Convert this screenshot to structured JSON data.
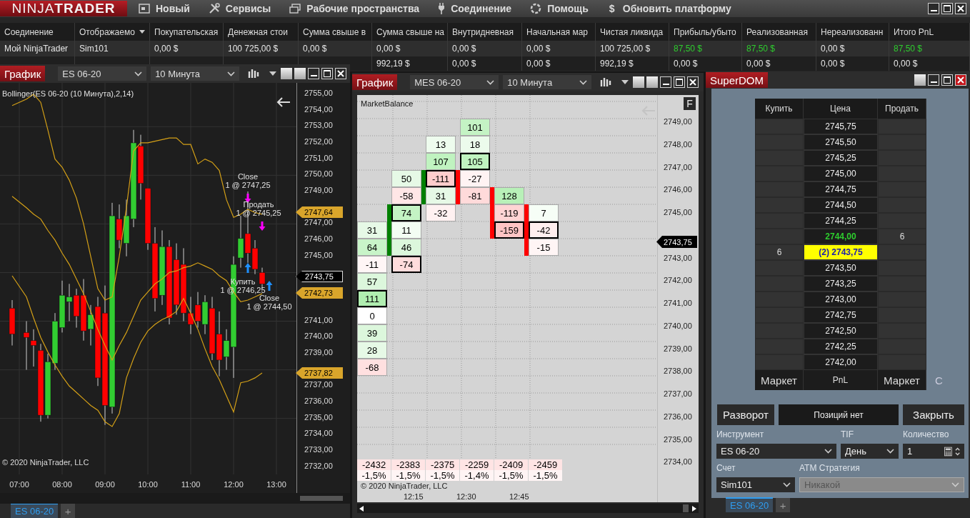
{
  "menu_bar": {
    "logo": "NINJA**TRADER**",
    "items": [
      {
        "label": "Новый",
        "kind": "new"
      },
      {
        "label": "Сервисы",
        "kind": "tools"
      },
      {
        "label": "Рабочие пространства",
        "kind": "workspaces"
      },
      {
        "label": "Соединение",
        "kind": "connection"
      },
      {
        "label": "Помощь",
        "kind": "help"
      },
      {
        "label": "Обновить платформу",
        "kind": "upgrade",
        "glyph": "$"
      }
    ]
  },
  "accounts_table": {
    "columns": [
      {
        "label": "Соединение",
        "kind": "plain"
      },
      {
        "label": "Отображаемо",
        "kind": "menu"
      },
      {
        "label": "Покупательская",
        "kind": "plain"
      },
      {
        "label": "Денежная стои",
        "kind": "plain"
      },
      {
        "label": "Сумма свыше в",
        "kind": "plain"
      },
      {
        "label": "Сумма свыше на",
        "kind": "plain"
      },
      {
        "label": "Внутридневная",
        "kind": "plain"
      },
      {
        "label": "Начальная мар",
        "kind": "plain"
      },
      {
        "label": "Чистая ликвида",
        "kind": "plain"
      },
      {
        "label": "Прибыль/убыто",
        "kind": "plain"
      },
      {
        "label": "Реализованная",
        "kind": "plain"
      },
      {
        "label": "Нереализованн",
        "kind": "plain"
      },
      {
        "label": "Итого PnL",
        "kind": "plain"
      }
    ],
    "rows": [
      {
        "cells": [
          {
            "text": "Мой NinjaTrader",
            "positive": false
          },
          {
            "text": "Sim101",
            "positive": false
          },
          {
            "text": "0,00 $",
            "positive": false
          },
          {
            "text": "100 725,00 $",
            "positive": false
          },
          {
            "text": "0,00 $",
            "positive": false
          },
          {
            "text": "0,00 $",
            "positive": false
          },
          {
            "text": "0,00 $",
            "positive": false
          },
          {
            "text": "0,00 $",
            "positive": false
          },
          {
            "text": "100 725,00 $",
            "positive": false
          },
          {
            "text": "87,50 $",
            "positive": true
          },
          {
            "text": "87,50 $",
            "positive": true
          },
          {
            "text": "0,00 $",
            "positive": false
          },
          {
            "text": "87,50 $",
            "positive": true
          }
        ]
      },
      {
        "cells": [
          null,
          null,
          null,
          null,
          null,
          {
            "text": "992,19 $",
            "positive": false
          },
          {
            "text": "0,00 $",
            "positive": false
          },
          {
            "text": "0,00 $",
            "positive": false
          },
          {
            "text": "992,19 $",
            "positive": false
          },
          {
            "text": "0,00 $",
            "positive": false
          },
          {
            "text": "0,00 $",
            "positive": false
          },
          {
            "text": "0,00 $",
            "positive": false
          },
          {
            "text": "0,00 $",
            "positive": false
          }
        ]
      }
    ]
  },
  "chart_left": {
    "title": "График",
    "instrument": "ES 06-20",
    "interval": "10 Минута",
    "indicator_label": "Bollinger(ES 06-20 (10 Минута),2,14)",
    "chart_data": {
      "type": "candlestick",
      "grid": true,
      "x": [
        410,
        430,
        440,
        450,
        460,
        470,
        480,
        490,
        500,
        510,
        520,
        530,
        540,
        550,
        560,
        570,
        580,
        590,
        600,
        610,
        620,
        630,
        640,
        650,
        660,
        670,
        680,
        690,
        700,
        710,
        720,
        730,
        740,
        750,
        760
      ],
      "ohlc": [
        [
          2741.8,
          2742.3,
          2739.5,
          2740.2
        ],
        [
          2740.3,
          2741,
          2738,
          2740.0
        ],
        [
          2739.8,
          2740.5,
          2738.2,
          2739.5
        ],
        [
          2739.2,
          2739.6,
          2734.8,
          2735.2
        ],
        [
          2735.2,
          2739,
          2735,
          2738.5
        ],
        [
          2738.4,
          2741.5,
          2738,
          2741
        ],
        [
          2740.6,
          2743.5,
          2740.3,
          2742.6
        ],
        [
          2742.2,
          2743.3,
          2741,
          2742.5
        ],
        [
          2742.6,
          2743,
          2740.6,
          2741.3
        ],
        [
          2742.6,
          2743.6,
          2739.8,
          2740.4
        ],
        [
          2740.5,
          2742,
          2739.5,
          2741.4
        ],
        [
          2741.9,
          2742.5,
          2737,
          2737.5
        ],
        [
          2741.5,
          2743.2,
          2734.6,
          2735.8
        ],
        [
          2735.7,
          2748.3,
          2735.3,
          2747.5
        ],
        [
          2747.3,
          2748.2,
          2745.5,
          2746
        ],
        [
          2745.8,
          2748.5,
          2745,
          2747.5
        ],
        [
          2747.3,
          2752.8,
          2746.8,
          2752
        ],
        [
          2751.8,
          2752.5,
          2748.5,
          2749.5
        ],
        [
          2749.2,
          2749.2,
          2745.4,
          2745.8
        ],
        [
          2745.8,
          2746.8,
          2741.6,
          2742.4
        ],
        [
          2742.6,
          2746.6,
          2742,
          2745.6
        ],
        [
          2745.6,
          2746,
          2740.8,
          2741.2
        ],
        [
          2744.8,
          2745.8,
          2741.4,
          2742
        ],
        [
          2744.5,
          2745.5,
          2741,
          2741.5
        ],
        [
          2741.5,
          2742.5,
          2740.2,
          2740.8
        ],
        [
          2742,
          2742.8,
          2740.6,
          2741
        ],
        [
          2740.8,
          2742.6,
          2740.2,
          2742.2
        ],
        [
          2741.8,
          2742.5,
          2738.6,
          2739
        ],
        [
          2740.2,
          2741.6,
          2737.6,
          2738.6
        ],
        [
          2738.8,
          2740.5,
          2738,
          2739.8
        ],
        [
          2739.4,
          2745,
          2737.5,
          2744.5
        ],
        [
          2744.9,
          2747.5,
          2744.3,
          2746.1
        ],
        [
          2746.4,
          2749,
          2744.6,
          2745.2
        ],
        [
          2745.5,
          2746,
          2743.9,
          2744.2
        ],
        [
          2744.0,
          2744.3,
          2743,
          2743.3
        ]
      ],
      "series": [
        {
          "type": "line",
          "color": "#d4a017",
          "values": [
            2754.3,
            2754.7,
            2755,
            2754.5,
            2752.8,
            2751,
            2750.5,
            2749.7,
            2748.6,
            2747,
            2745,
            2743,
            2742.3,
            2742.5,
            2745,
            2748,
            2751.5,
            2752,
            2752,
            2752.1,
            2752.2,
            2752.3,
            2752.3,
            2751.9,
            2751.9,
            2750.7,
            2751,
            2750.8,
            2750.3,
            2748.5,
            2747.4,
            2747.6,
            2747.9,
            2747.7,
            2747.6
          ]
        },
        {
          "type": "line",
          "color": "#d4a017",
          "values": [
            2748.7,
            2748,
            2747.6,
            2747.3,
            2746.6,
            2746,
            2745.2,
            2744.5,
            2743.6,
            2742.7,
            2741.6,
            2740.5,
            2739.5,
            2738.6,
            2739.5,
            2740.3,
            2741.3,
            2742.3,
            2742.8,
            2743.3,
            2743.6,
            2744,
            2744.1,
            2744.3,
            2744.4,
            2744.6,
            2744.4,
            2744.2,
            2743.8,
            2743.5,
            2742.8,
            2742.2,
            2742.3,
            2742.5,
            2742.7
          ]
        },
        {
          "type": "line",
          "color": "#d4a017",
          "values": [
            2743.8,
            2742.5,
            2741.2,
            2740,
            2739.1,
            2738.3,
            2737.6,
            2737,
            2736.6,
            2736.2,
            2735.8,
            2735.5,
            2734.8,
            2734.5,
            2735.3,
            2737.5,
            2738.7,
            2739.7,
            2740.4,
            2740.8,
            2741.1,
            2741.3,
            2741.6,
            2742.4,
            2741.5,
            2740.5,
            2739.3,
            2738.2,
            2737.4,
            2736.4,
            2735.4,
            2737.2,
            2737.3,
            2737.5,
            2737.8
          ]
        }
      ],
      "xlim": [
        393,
        883
      ],
      "xticks": [
        {
          "value": 420,
          "label": "07:00"
        },
        {
          "value": 480,
          "label": "08:00"
        },
        {
          "value": 540,
          "label": "09:00"
        },
        {
          "value": 600,
          "label": "10:00"
        },
        {
          "value": 660,
          "label": "11:00"
        },
        {
          "value": 720,
          "label": "12:00"
        },
        {
          "value": 780,
          "label": "13:00"
        }
      ],
      "yticks": [
        {
          "value": 2755,
          "label": "2755,00"
        },
        {
          "value": 2754,
          "label": "2754,00"
        },
        {
          "value": 2753,
          "label": "2753,00"
        },
        {
          "value": 2752,
          "label": "2752,00"
        },
        {
          "value": 2751,
          "label": "2751,00"
        },
        {
          "value": 2750,
          "label": "2750,00"
        },
        {
          "value": 2749,
          "label": "2749,00"
        },
        {
          "value": 2747,
          "label": "2747,00"
        },
        {
          "value": 2746,
          "label": "2746,00"
        },
        {
          "value": 2745,
          "label": "2745,00"
        },
        {
          "value": 2741,
          "label": "2741,00"
        },
        {
          "value": 2740,
          "label": "2740,00"
        },
        {
          "value": 2739,
          "label": "2739,00"
        },
        {
          "value": 2737,
          "label": "2737,00"
        },
        {
          "value": 2736,
          "label": "2736,00"
        },
        {
          "value": 2735,
          "label": "2735,00"
        },
        {
          "value": 2734,
          "label": "2734,00"
        },
        {
          "value": 2733,
          "label": "2733,00"
        },
        {
          "value": 2732,
          "label": "2732,00"
        }
      ],
      "ylim": [
        2730.4,
        2755.7
      ]
    },
    "price_markers": [
      {
        "text": "2747,64",
        "kind": "indicator"
      },
      {
        "text": "2743,75",
        "kind": "last"
      },
      {
        "text": "2742,73",
        "kind": "indicator"
      },
      {
        "text": "2737,82",
        "kind": "indicator"
      }
    ],
    "orders": [
      {
        "action": "Close",
        "detail": "1 @ 2747,25"
      },
      {
        "action": "Продать",
        "detail": "1 @ 2745,25"
      },
      {
        "action": "Купить",
        "detail": "1 @ 2746,25"
      },
      {
        "action": "Close",
        "detail": "1 @ 2744,50"
      }
    ],
    "copyright": "© 2020 NinjaTrader, LLC",
    "tabs": [
      {
        "label": "ES 06-20",
        "selected": true
      }
    ],
    "add_tab": "+"
  },
  "chart_middle": {
    "title": "График",
    "instrument": "MES 06-20",
    "interval": "10 Минута",
    "indicator_label": "MarketBalance",
    "panel_button": "F",
    "columns": [
      {
        "cells": [
          null,
          null,
          null,
          null,
          null,
          null,
          {
            "value": "31",
            "color": "#e6f9e6",
            "outlined": false
          },
          {
            "value": "64",
            "color": "#c8f4c8",
            "outlined": false
          },
          {
            "value": "-11",
            "color": "#fff6f6",
            "outlined": false
          },
          {
            "value": "57",
            "color": "#dcf7dc",
            "outlined": false
          },
          {
            "value": "111",
            "color": "#b0eeb0",
            "outlined": true
          },
          {
            "value": "0",
            "color": "#ffffff",
            "outlined": false
          },
          {
            "value": "39",
            "color": "#dcf7dc",
            "outlined": false
          },
          {
            "value": "28",
            "color": "#e6f9e6",
            "outlined": false
          },
          {
            "value": "-68",
            "color": "#ffe0e0",
            "outlined": false
          }
        ],
        "delta": "-2432",
        "percent": "-1,5%"
      },
      {
        "cells": [
          null,
          null,
          null,
          {
            "value": "50",
            "color": "#e6f9e6",
            "outlined": false
          },
          {
            "value": "-58",
            "color": "#ffe6e6",
            "outlined": false
          },
          {
            "value": "74",
            "color": "#c4f3c4",
            "outlined": true,
            "bar": {
              "color": "#008000"
            }
          },
          {
            "value": "11",
            "color": "#f3fdf3",
            "outlined": false,
            "bar": {
              "color": "#008000"
            }
          },
          {
            "value": "46",
            "color": "#dcf7dc",
            "outlined": false,
            "bar": {
              "color": "#008000"
            }
          },
          {
            "value": "-74",
            "color": "#ffdcdc",
            "outlined": true
          }
        ],
        "delta": "-2383",
        "percent": "-1,5%"
      },
      {
        "cells": [
          null,
          {
            "value": "13",
            "color": "#eefcee",
            "outlined": false
          },
          {
            "value": "107",
            "color": "#c0f3c0",
            "outlined": false
          },
          {
            "value": "-111",
            "color": "#ffcccc",
            "outlined": true,
            "bar": {
              "color": "#008000"
            }
          },
          {
            "value": "31",
            "color": "#e6f9e6",
            "outlined": false,
            "bar": {
              "color": "#008000"
            }
          },
          {
            "value": "-32",
            "color": "#fff1f1",
            "outlined": false
          }
        ],
        "delta": "-2375",
        "percent": "-1,5%"
      },
      {
        "cells": [
          {
            "value": "101",
            "color": "#c4f3c4",
            "outlined": false
          },
          {
            "value": "18",
            "color": "#ecfbec",
            "outlined": false
          },
          {
            "value": "105",
            "color": "#c0f3c0",
            "outlined": true
          },
          {
            "value": "-27",
            "color": "#fff3f3",
            "outlined": false,
            "bar": {
              "color": "#ff0000"
            }
          },
          {
            "value": "-81",
            "color": "#ffdada",
            "outlined": false,
            "bar": {
              "color": "#ff0000"
            }
          }
        ],
        "delta": "-2259",
        "percent": "-1,4%"
      },
      {
        "cells": [
          null,
          null,
          null,
          null,
          {
            "value": "128",
            "color": "#b8f0b8",
            "outlined": false,
            "bar": {
              "color": "#ff0000"
            }
          },
          {
            "value": "-119",
            "color": "#ffd4d4",
            "outlined": false,
            "bar": {
              "color": "#ff0000"
            }
          },
          {
            "value": "-159",
            "color": "#ffc4c4",
            "outlined": true,
            "bar": {
              "color": "#ff0000"
            }
          }
        ],
        "delta": "-2409",
        "percent": "-1,5%"
      },
      {
        "cells": [
          null,
          null,
          null,
          null,
          null,
          {
            "value": "7",
            "color": "#f6fef6",
            "outlined": false,
            "bar": {
              "color": "#ff0000"
            }
          },
          {
            "value": "-42",
            "color": "#ffeeee",
            "outlined": true,
            "bar": {
              "color": "#ff0000"
            }
          },
          {
            "value": "-15",
            "color": "#fff5f5",
            "outlined": false,
            "bar": {
              "color": "#ff0000"
            }
          }
        ],
        "delta": "-2459",
        "percent": "-1,5%"
      }
    ],
    "price_ticks": [
      "2749,00",
      "2748,00",
      "2747,00",
      "2746,00",
      "2745,00",
      "2743,00",
      "2742,00",
      "2741,00",
      "2740,00",
      "2739,00",
      "2738,00",
      "2737,00",
      "2736,00",
      "2735,00",
      "2734,00"
    ],
    "price_marker": "2743,75",
    "time_ticks": [
      "12:15",
      "12:30",
      "12:45"
    ],
    "copyright": "© 2020 NinjaTrader, LLC"
  },
  "superdom": {
    "title": "SuperDOM",
    "columns": [
      "Купить",
      "Цена",
      "Продать"
    ],
    "rows": [
      {
        "price": "2745,75",
        "kind": "plain"
      },
      {
        "price": "2745,50",
        "kind": "plain"
      },
      {
        "price": "2745,25",
        "kind": "plain"
      },
      {
        "price": "2745,00",
        "kind": "plain"
      },
      {
        "price": "2744,75",
        "kind": "plain"
      },
      {
        "price": "2744,50",
        "kind": "plain"
      },
      {
        "price": "2744,25",
        "kind": "plain"
      },
      {
        "price": "2744,00",
        "sell": "6",
        "kind": "last"
      },
      {
        "price": "(2) 2743,75",
        "buy": "6",
        "kind": "position"
      },
      {
        "price": "2743,50",
        "kind": "plain"
      },
      {
        "price": "2743,25",
        "kind": "plain"
      },
      {
        "price": "2743,00",
        "kind": "plain"
      },
      {
        "price": "2742,75",
        "kind": "plain"
      },
      {
        "price": "2742,50",
        "kind": "plain"
      },
      {
        "price": "2742,25",
        "kind": "plain"
      },
      {
        "price": "2742,00",
        "kind": "plain"
      }
    ],
    "footer": {
      "buy": "Маркет",
      "price": "PnL",
      "sell": "Маркет",
      "toggle": "C"
    },
    "reverse_button": "Разворот",
    "position": "Позиций нет",
    "close_button": "Закрыть",
    "fields": [
      {
        "label": "Инструмент",
        "value": "ES 06-20",
        "kind": "select",
        "disabled": false
      },
      {
        "label": "TIF",
        "value": "День",
        "kind": "select",
        "disabled": false
      },
      {
        "label": "Количество",
        "value": "1",
        "kind": "number",
        "disabled": false
      },
      {
        "label": "Счет",
        "value": "Sim101",
        "kind": "select",
        "disabled": false
      },
      {
        "label": "ATM Стратегия",
        "value": "Никакой",
        "kind": "select",
        "disabled": true
      }
    ],
    "tabs": [
      {
        "label": "ES 06-20",
        "selected": true
      }
    ],
    "add_tab": "+"
  }
}
